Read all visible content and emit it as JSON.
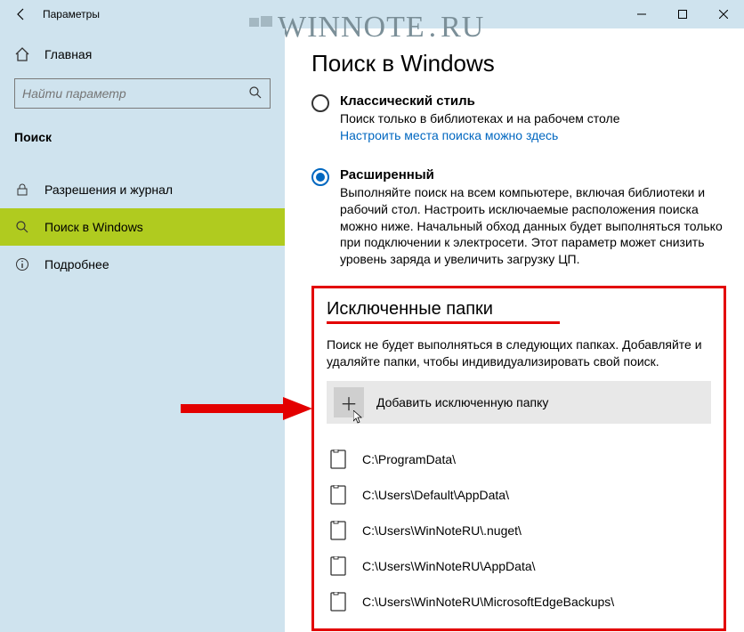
{
  "window": {
    "title": "Параметры"
  },
  "sidebar": {
    "home": "Главная",
    "search_placeholder": "Найти параметр",
    "section": "Поиск",
    "items": [
      {
        "label": "Разрешения и журнал"
      },
      {
        "label": "Поиск в Windows"
      },
      {
        "label": "Подробнее"
      }
    ]
  },
  "main": {
    "page_title": "Поиск в Windows",
    "classic": {
      "label": "Классический стиль",
      "desc": "Поиск только в библиотеках и на рабочем столе",
      "link": "Настроить места поиска можно здесь"
    },
    "advanced": {
      "label": "Расширенный",
      "desc": "Выполняйте поиск на всем компьютере, включая библиотеки и рабочий стол. Настроить исключаемые расположения поиска можно ниже. Начальный обход данных будет выполняться только при подключении к электросети. Этот параметр может снизить уровень заряда и увеличить загрузку ЦП."
    },
    "excluded": {
      "heading": "Исключенные папки",
      "desc": "Поиск не будет выполняться в следующих папках. Добавляйте и удаляйте папки, чтобы индивидуализировать свой поиск.",
      "add_label": "Добавить исключенную папку",
      "folders": [
        "C:\\ProgramData\\",
        "C:\\Users\\Default\\AppData\\",
        "C:\\Users\\WinNoteRU\\.nuget\\",
        "C:\\Users\\WinNoteRU\\AppData\\",
        "C:\\Users\\WinNoteRU\\MicrosoftEdgeBackups\\"
      ]
    }
  },
  "watermark": {
    "text1": "WINNOTE",
    "text2": "RU"
  }
}
